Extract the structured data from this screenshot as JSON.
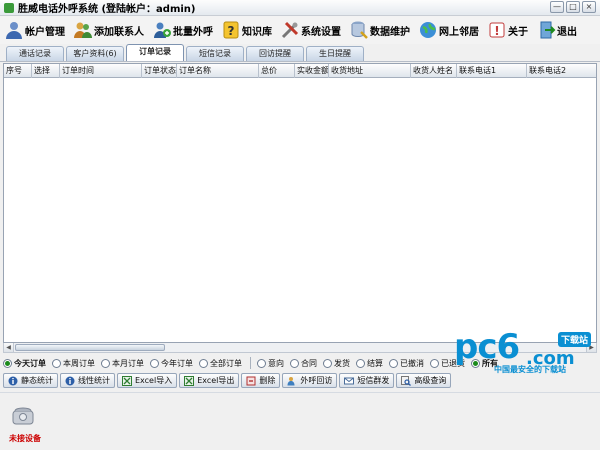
{
  "window": {
    "title": "胜威电话外呼系统  (登陆帐户：admin)",
    "controls": [
      "—",
      "□",
      "×"
    ]
  },
  "toolbar": {
    "items": [
      {
        "label": "帐户管理",
        "icon": "user-icon"
      },
      {
        "label": "添加联系人",
        "icon": "add-contact-icon"
      },
      {
        "label": "批量外呼",
        "icon": "bulk-call-icon"
      },
      {
        "label": "知识库",
        "icon": "help-icon"
      },
      {
        "label": "系统设置",
        "icon": "tools-icon"
      },
      {
        "label": "数据维护",
        "icon": "database-icon"
      },
      {
        "label": "网上邻居",
        "icon": "globe-icon"
      },
      {
        "label": "关于",
        "icon": "info-icon"
      },
      {
        "label": "退出",
        "icon": "exit-icon"
      }
    ]
  },
  "tabs": [
    {
      "label": "通话记录",
      "active": false
    },
    {
      "label": "客户资料(6)",
      "active": false
    },
    {
      "label": "订单记录",
      "active": true
    },
    {
      "label": "短信记录",
      "active": false
    },
    {
      "label": "回访提醒",
      "active": false
    },
    {
      "label": "生日提醒",
      "active": false
    }
  ],
  "grid": {
    "columns": [
      "序号",
      "选择",
      "订单时间",
      "订单状态",
      "订单名称",
      "总价",
      "实收金额",
      "收货地址",
      "收货人姓名",
      "联系电话1",
      "联系电话2"
    ],
    "rows": []
  },
  "filters": {
    "time": [
      {
        "label": "今天订单",
        "checked": true
      },
      {
        "label": "本周订单",
        "checked": false
      },
      {
        "label": "本月订单",
        "checked": false
      },
      {
        "label": "今年订单",
        "checked": false
      },
      {
        "label": "全部订单",
        "checked": false
      }
    ],
    "status": [
      {
        "label": "意向",
        "checked": false
      },
      {
        "label": "合同",
        "checked": false
      },
      {
        "label": "发货",
        "checked": false
      },
      {
        "label": "结算",
        "checked": false
      },
      {
        "label": "已撤消",
        "checked": false
      },
      {
        "label": "已退货",
        "checked": false
      },
      {
        "label": "所有",
        "checked": true
      }
    ]
  },
  "actions": [
    {
      "label": "静态统计",
      "icon": "info-icon"
    },
    {
      "label": "线性统计",
      "icon": "info-icon"
    },
    {
      "label": "Excel导入",
      "icon": "excel-icon"
    },
    {
      "label": "Excel导出",
      "icon": "excel-icon"
    },
    {
      "label": "删除",
      "icon": "delete-icon"
    },
    {
      "label": "外呼回访",
      "icon": "call-icon"
    },
    {
      "label": "短信群发",
      "icon": "sms-icon"
    },
    {
      "label": "高级查询",
      "icon": "search-icon"
    }
  ],
  "status": {
    "device_label": "未接设备"
  },
  "watermark": {
    "logo": "pc6",
    "tag": "下载站",
    "domain": ".com",
    "slogan": "中国最安全的下载站"
  }
}
